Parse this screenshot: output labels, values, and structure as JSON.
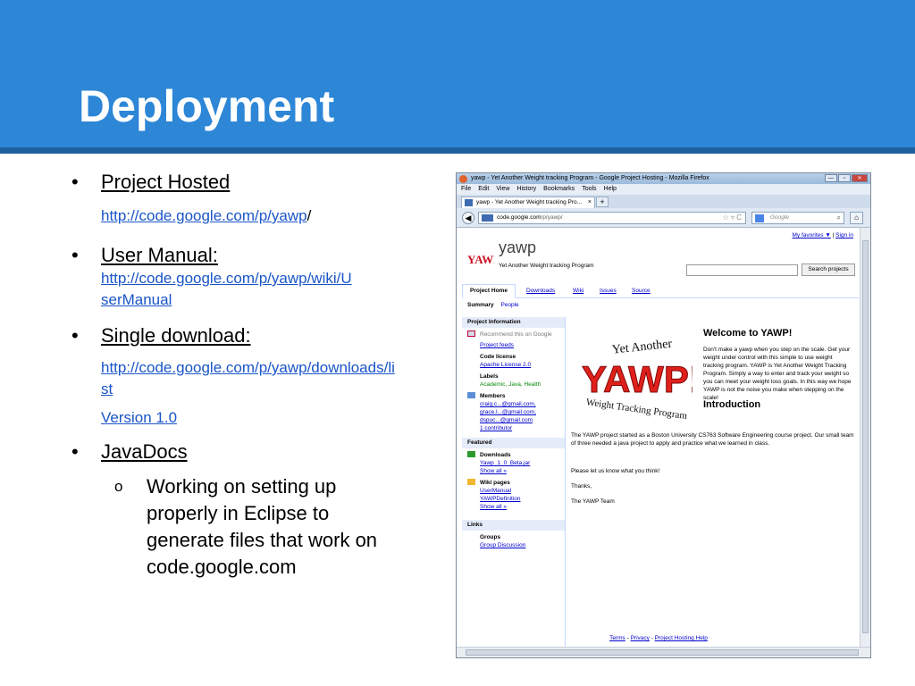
{
  "slide": {
    "title": "Deployment",
    "colors": {
      "header": "#2d86d6",
      "rule": "#1f5fa0",
      "link": "#1a55c8"
    }
  },
  "bullets": {
    "b1_label": "Project Hosted",
    "b1_link": "http://code.google.com/p/yawp",
    "b1_suffix": "/",
    "b2_label": "User Manual:",
    "b2_link": "http://code.google.com/p/yawp/wiki/UserManual",
    "b3_label": "Single download:",
    "b3_link": "http://code.google.com/p/yawp/downloads/list",
    "b3_version": "Version 1.0",
    "b4_label": "JavaDocs",
    "b4_sub_marker": "o",
    "b4_sub": "Working on setting up properly in Eclipse to generate files that work on code.google.com"
  },
  "browser": {
    "window_title": "yawp - Yet Another Weight tracking Program - Google Project Hosting - Mozilla Firefox",
    "menu": [
      "File",
      "Edit",
      "View",
      "History",
      "Bookmarks",
      "Tools",
      "Help"
    ],
    "tab_title": "yawp - Yet Another Weight tracking Pro...",
    "url_domain": "code.google.com",
    "url_prefix": "code.",
    "url_path": "/p/yawp/",
    "search_placeholder": "Google",
    "win_buttons": [
      "—",
      "▫",
      "✕"
    ]
  },
  "page": {
    "my_favorites": "My favorites ▼",
    "sep": "|",
    "sign_in": "Sign in",
    "project_name": "yawp",
    "project_summary": "Yet Another Weight tracking Program",
    "search_button": "Search projects",
    "tabs": [
      "Project Home",
      "Downloads",
      "Wiki",
      "Issues",
      "Source"
    ],
    "subtabs": [
      "Summary",
      "People"
    ],
    "sidebar": {
      "project_info": "Project Information",
      "recommend": "Recommend this on Google",
      "project_feeds": "Project feeds",
      "code_license_label": "Code license",
      "code_license": "Apache License 2.0",
      "labels_label": "Labels",
      "labels": "Academic, Java, Health",
      "members_label": "Members",
      "members": [
        "craig.c...@gmail.com,",
        "grace.l...@gmail.com,",
        "dspuc...@gmail.com"
      ],
      "contributor": "1 contributor",
      "featured": "Featured",
      "downloads_label": "Downloads",
      "download_file": "Yawp_1_0_Beta.jar",
      "show_all": "Show all »",
      "wiki_label": "Wiki pages",
      "wiki_pages": [
        "UserManual",
        "YAWPDefinition"
      ],
      "links": "Links",
      "groups_label": "Groups",
      "group_discussion": "Group Discussion"
    },
    "logo_art": {
      "top": "Yet Another",
      "main": "YAWP!",
      "bottom": "Weight Tracking Program"
    },
    "welcome_title": "Welcome to YAWP!",
    "welcome_text": "Don't make a yawp when you step on the scale. Get your weight under control with this simple to use weight tracking program. YAWP is Yet Another Weight Tracking Program. Simply a way to enter and track your weight so you can meet your weight loss goals. In this way we hope YAWP is not the noise you make when stepping on the scale!",
    "intro_title": "Introduction",
    "intro_text": "The YAWP project started as a Boston University CS763 Software Engineering course project. Our small team of three needed a java project to apply and practice what we learned in class.",
    "let_us_know": "Please let us know what you think!",
    "thanks": "Thanks,",
    "team": "The YAWP Team",
    "footer": [
      "Terms",
      "Privacy",
      "Project Hosting Help"
    ],
    "footer_sep": "-"
  }
}
